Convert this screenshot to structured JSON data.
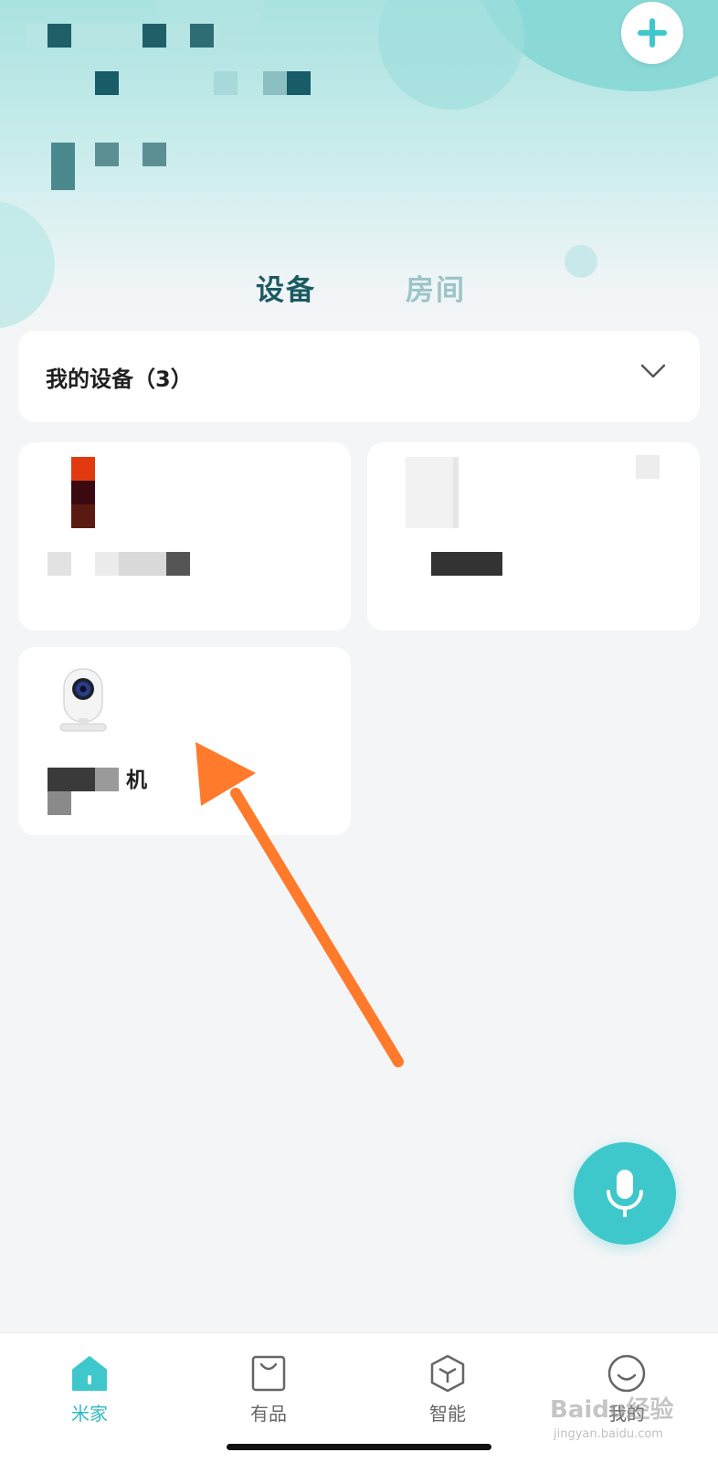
{
  "header": {
    "add_icon": "plus-icon"
  },
  "tabs": [
    {
      "label": "设备",
      "active": true
    },
    {
      "label": "房间",
      "active": false
    }
  ],
  "device_group": {
    "title": "我的设备（3）",
    "chevron_icon": "chevron-down-icon"
  },
  "devices": [
    {
      "name": "",
      "icon": "red-device-image"
    },
    {
      "name": "",
      "icon": "white-device-image"
    },
    {
      "name": "机",
      "icon": "camera-image"
    }
  ],
  "voice_button": {
    "icon": "microphone-icon"
  },
  "bottom_nav": [
    {
      "label": "米家",
      "icon": "home-icon",
      "active": true
    },
    {
      "label": "有品",
      "icon": "shopping-bag-icon",
      "active": false
    },
    {
      "label": "智能",
      "icon": "hexagon-cube-icon",
      "active": false
    },
    {
      "label": "我的",
      "icon": "smiley-profile-icon",
      "active": false
    }
  ],
  "watermark": {
    "text": "Baidu经验",
    "url": "jingyan.baidu.com"
  },
  "colors": {
    "accent": "#3ec8cc",
    "active_tab": "#1c5a63",
    "inactive_tab": "#9cc4c7",
    "arrow": "#ff7a2b"
  }
}
